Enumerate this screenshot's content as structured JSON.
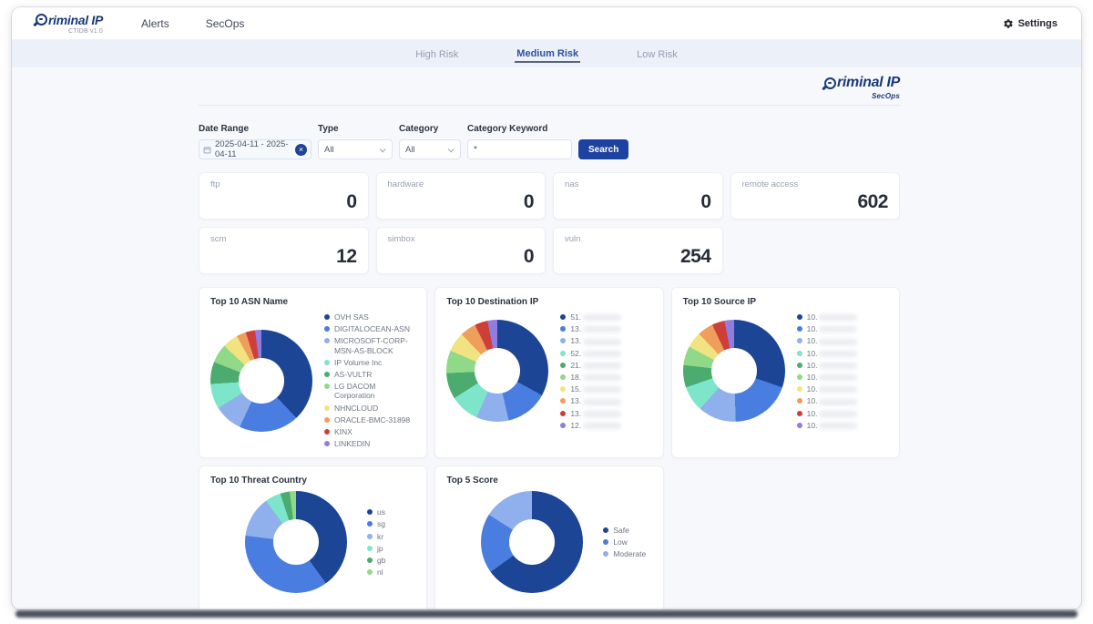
{
  "header": {
    "brand": {
      "name": "Criminal IP",
      "wordmark_rest": "riminal IP",
      "sub": "CTIDB v1.0"
    },
    "nav": [
      {
        "label": "Alerts"
      },
      {
        "label": "SecOps"
      }
    ],
    "settings_label": "Settings"
  },
  "tabs": [
    {
      "label": "High Risk",
      "active": false
    },
    {
      "label": "Medium Risk",
      "active": true
    },
    {
      "label": "Low Risk",
      "active": false
    }
  ],
  "secops_logo": {
    "name": "Criminal IP",
    "wordmark_rest": "riminal IP",
    "sub": "SecOps"
  },
  "filters": {
    "date_range": {
      "label": "Date Range",
      "value": "2025-04-11 - 2025-04-11"
    },
    "type": {
      "label": "Type",
      "value": "All"
    },
    "category": {
      "label": "Category",
      "value": "All"
    },
    "category_keyword": {
      "label": "Category Keyword",
      "value": "*"
    },
    "search_label": "Search"
  },
  "stat_cards": [
    {
      "label": "ftp",
      "value": "0"
    },
    {
      "label": "hardware",
      "value": "0"
    },
    {
      "label": "nas",
      "value": "0"
    },
    {
      "label": "remote access",
      "value": "602"
    },
    {
      "label": "scm",
      "value": "12"
    },
    {
      "label": "simbox",
      "value": "0"
    },
    {
      "label": "vuln",
      "value": "254"
    }
  ],
  "colors": {
    "brand_navy": "#1b3a7a",
    "button_blue": "#1e429f",
    "active_tab": "#2b50a1",
    "palette": [
      "#1d4596",
      "#4a7de0",
      "#8fb0ec",
      "#7de5c9",
      "#4cab6e",
      "#90d989",
      "#f2e382",
      "#f09e5b",
      "#cd3f38",
      "#8f7ddf"
    ]
  },
  "chart_data": [
    {
      "type": "pie",
      "donut": true,
      "title": "Top 10 ASN Name",
      "legend_position": "right",
      "labels": [
        "OVH SAS",
        "DIGITALOCEAN-ASN",
        "MICROSOFT-CORP-MSN-AS-BLOCK",
        "IP Volume Inc",
        "AS-VULTR",
        "LG DACOM Corporation",
        "NHNCLOUD",
        "ORACLE-BMC-31898",
        "KINX",
        "LINKEDIN"
      ],
      "values": [
        38,
        19,
        9,
        8,
        7,
        6,
        5,
        3,
        3,
        2
      ],
      "colors": [
        "#1d4596",
        "#4a7de0",
        "#8fb0ec",
        "#7de5c9",
        "#4cab6e",
        "#90d989",
        "#f2e382",
        "#f09e5b",
        "#cd3f38",
        "#8f7ddf"
      ],
      "redacted": false
    },
    {
      "type": "pie",
      "donut": true,
      "title": "Top 10 Destination IP",
      "legend_position": "right",
      "labels": [
        "51.",
        "13.",
        "13.",
        "52.",
        "21.",
        "18.",
        "15.",
        "13.",
        "13.",
        "12."
      ],
      "values": [
        32,
        13,
        10,
        9,
        8,
        7,
        6,
        5,
        4,
        3
      ],
      "colors": [
        "#1d4596",
        "#4a7de0",
        "#8fb0ec",
        "#7de5c9",
        "#4cab6e",
        "#90d989",
        "#f2e382",
        "#f09e5b",
        "#cd3f38",
        "#8f7ddf"
      ],
      "redacted": true
    },
    {
      "type": "pie",
      "donut": true,
      "title": "Top 10 Source IP",
      "legend_position": "right",
      "labels": [
        "10.",
        "10.",
        "10.",
        "10.",
        "10.",
        "10.",
        "10.",
        "10.",
        "10.",
        "10."
      ],
      "values": [
        30,
        19,
        12,
        8,
        7,
        6,
        5,
        5,
        4,
        3
      ],
      "colors": [
        "#1d4596",
        "#4a7de0",
        "#8fb0ec",
        "#7de5c9",
        "#4cab6e",
        "#90d989",
        "#f2e382",
        "#f09e5b",
        "#cd3f38",
        "#8f7ddf"
      ],
      "redacted": true
    },
    {
      "type": "pie",
      "donut": true,
      "title": "Top 10 Threat Country",
      "legend_position": "right",
      "labels": [
        "us",
        "sg",
        "kr",
        "jp",
        "gb",
        "nl"
      ],
      "values": [
        40,
        37,
        13,
        5,
        3,
        2
      ],
      "colors": [
        "#1d4596",
        "#4a7de0",
        "#8fb0ec",
        "#7de5c9",
        "#4cab6e",
        "#90d989"
      ],
      "redacted": false
    },
    {
      "type": "pie",
      "donut": true,
      "title": "Top 5 Score",
      "legend_position": "right",
      "labels": [
        "Safe",
        "Low",
        "Moderate"
      ],
      "values": [
        65,
        19,
        16
      ],
      "colors": [
        "#1d4596",
        "#4a7de0",
        "#8fb0ec"
      ],
      "redacted": false
    }
  ]
}
